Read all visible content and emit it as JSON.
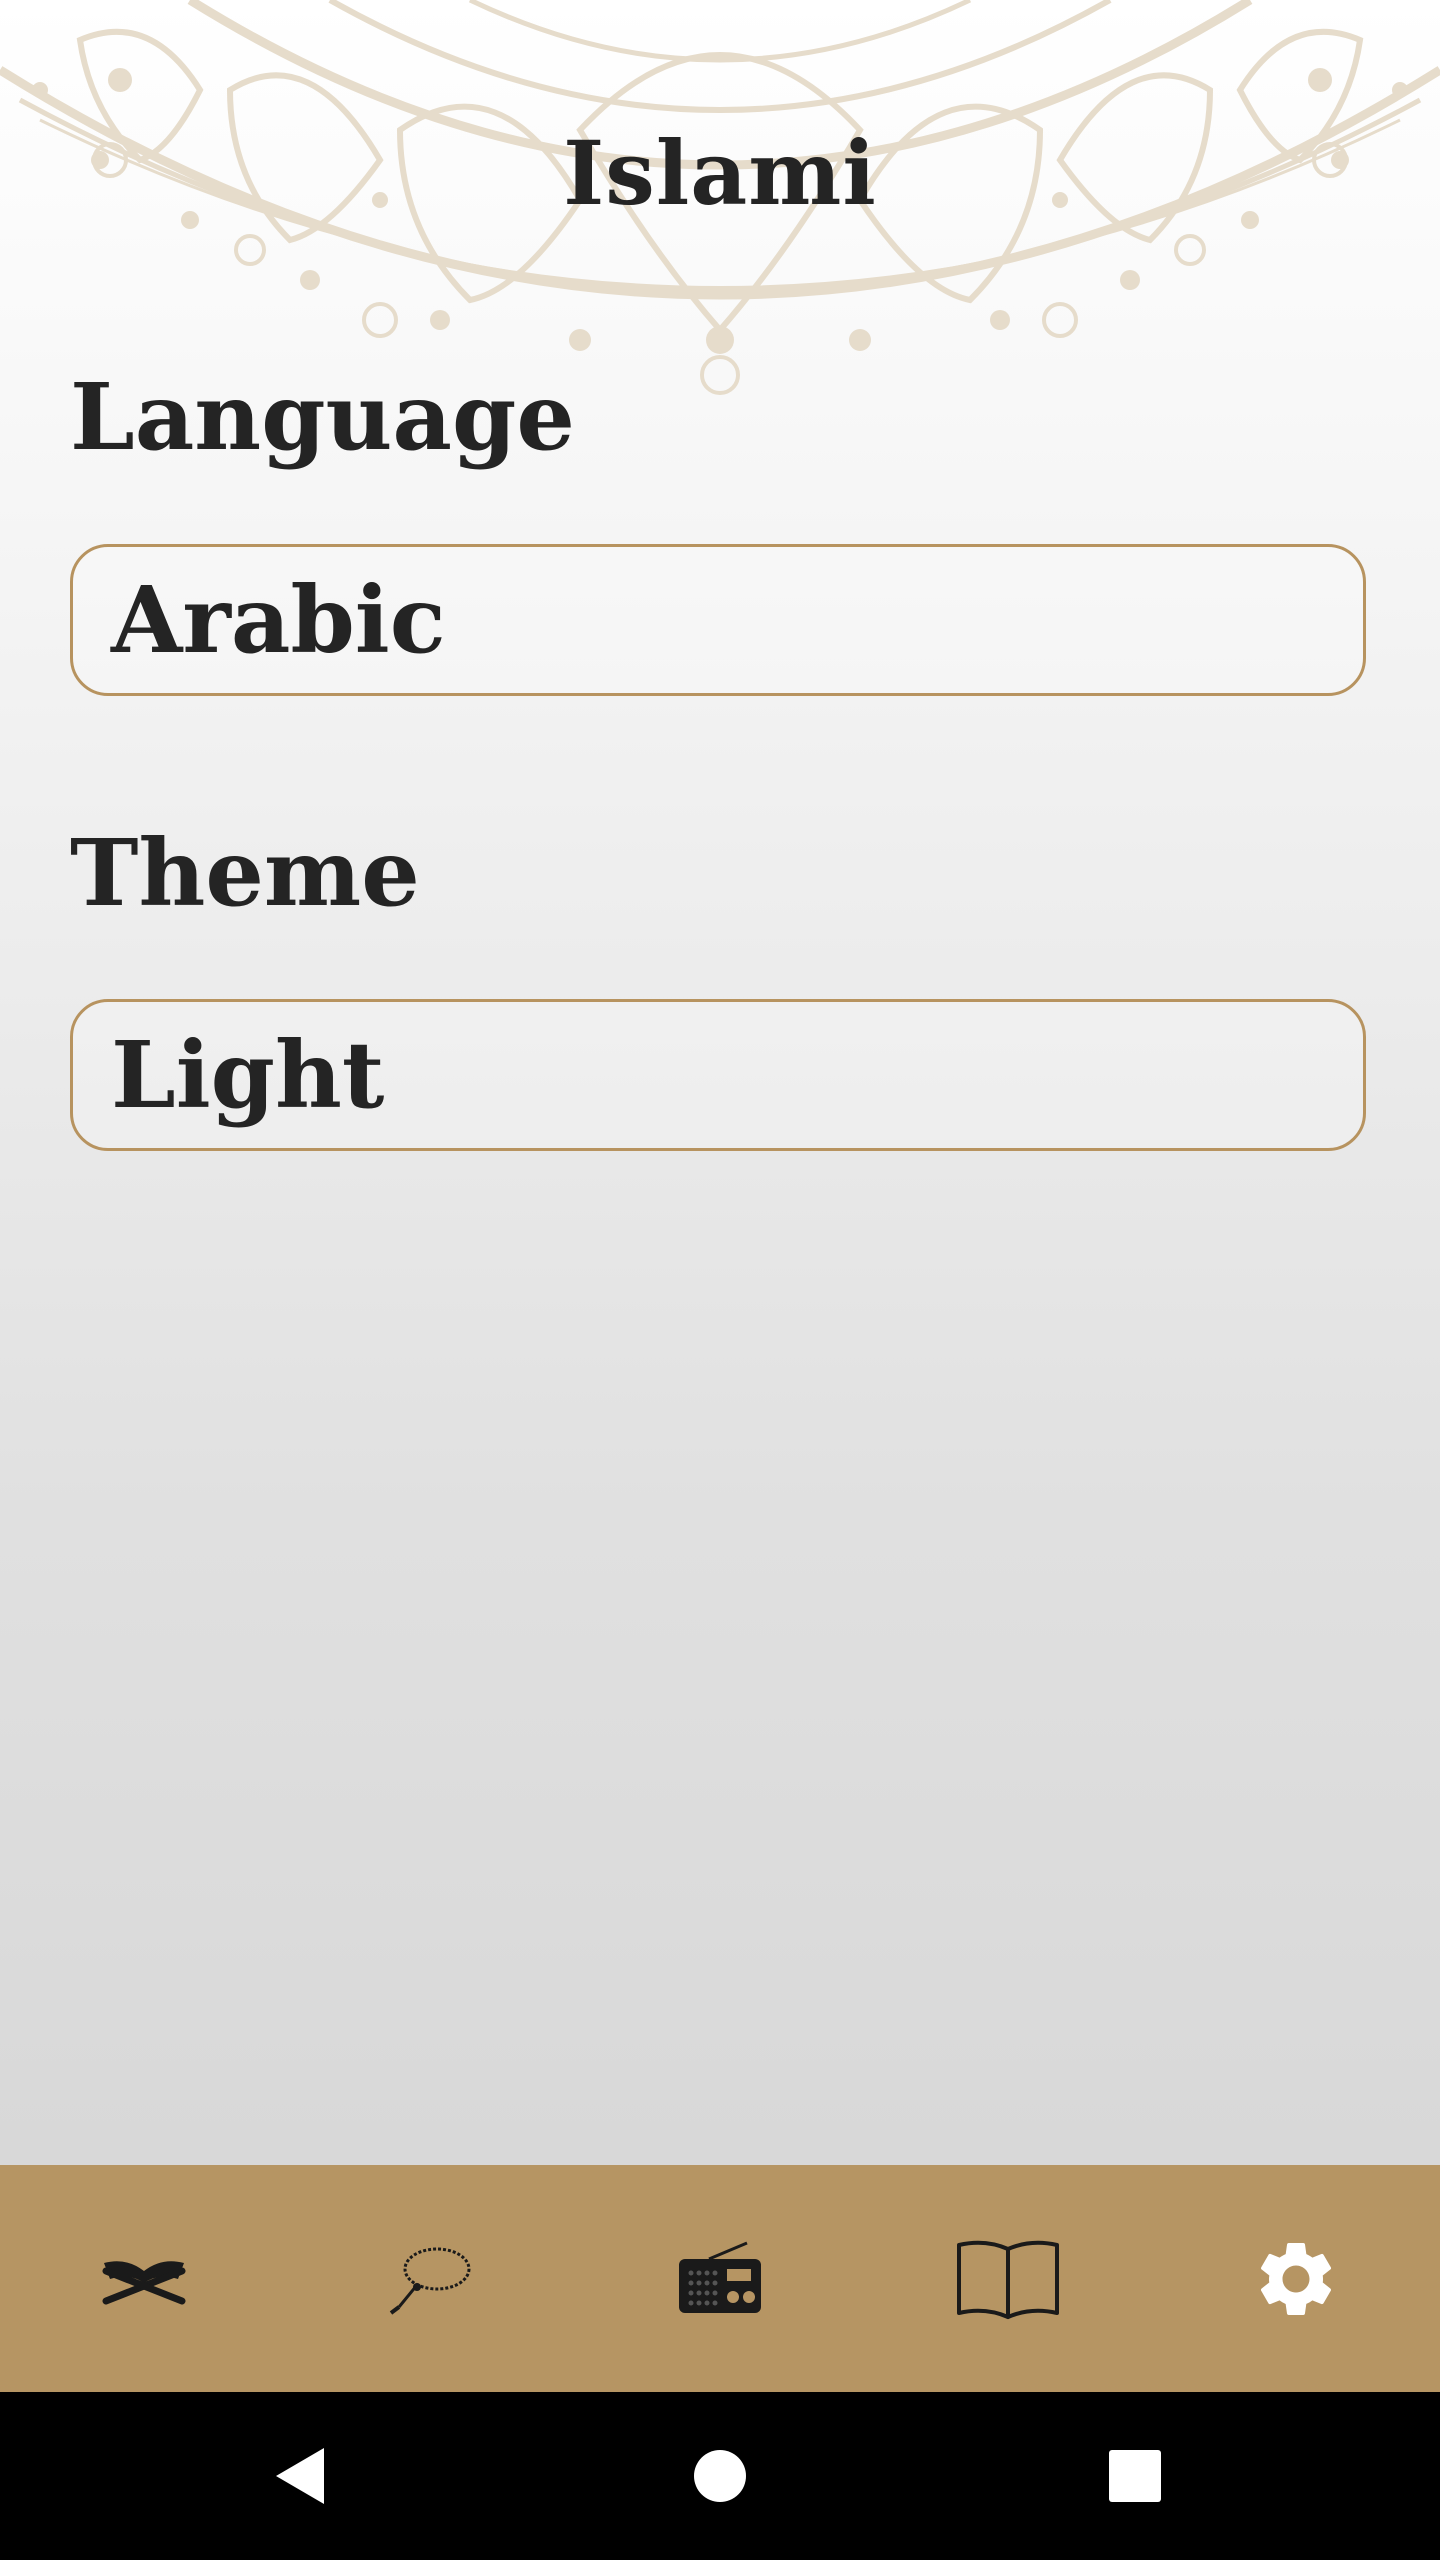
{
  "app": {
    "title": "Islami"
  },
  "settings": {
    "language": {
      "label": "Language",
      "selected": "Arabic"
    },
    "theme": {
      "label": "Theme",
      "selected": "Light"
    }
  },
  "bottom_nav": {
    "items": [
      {
        "icon": "quran-icon",
        "active": false
      },
      {
        "icon": "tasbeh-icon",
        "active": false
      },
      {
        "icon": "radio-icon",
        "active": false
      },
      {
        "icon": "book-icon",
        "active": false
      },
      {
        "icon": "gear-icon",
        "active": true
      }
    ]
  },
  "system_nav": {
    "buttons": [
      "back-icon",
      "home-icon",
      "recent-apps-icon"
    ]
  },
  "colors": {
    "accent": "#b69563",
    "field_border": "#b7935f",
    "text": "#242424",
    "active_icon": "#ffffff",
    "inactive_icon": "#1a1a1a",
    "mandala": "#e6dccb"
  }
}
